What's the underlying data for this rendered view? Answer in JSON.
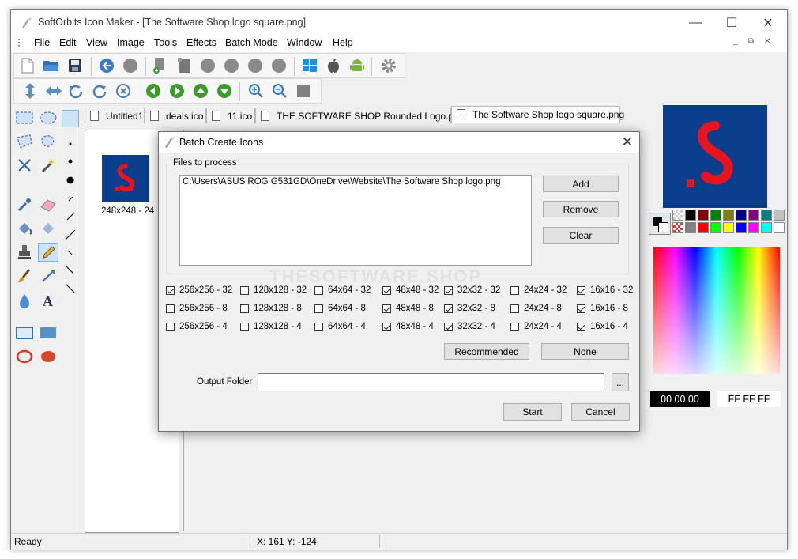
{
  "window": {
    "title": "SoftOrbits Icon Maker - [The Software Shop logo square.png]",
    "minimize": "—",
    "maximize": "☐",
    "close": "✕"
  },
  "menu": {
    "items": [
      "File",
      "Edit",
      "View",
      "Image",
      "Tools",
      "Effects",
      "Batch Mode",
      "Window",
      "Help"
    ],
    "mdi_buttons": [
      "_",
      "⧉",
      "✕"
    ]
  },
  "tabs": [
    {
      "label": "Untitled1",
      "active": false
    },
    {
      "label": "deals.ico",
      "active": false
    },
    {
      "label": "11.ico",
      "active": false
    },
    {
      "label": "THE SOFTWARE SHOP Rounded Logo.png",
      "active": false
    },
    {
      "label": "The Software Shop logo square.png",
      "active": true
    }
  ],
  "icon_list": {
    "item_label": "248x248 - 24"
  },
  "colors": {
    "hex_black": "00 00 00",
    "hex_white": "FF FF FF",
    "logo_bg": "#0a3d8c",
    "logo_fg": "#e6141e",
    "palette_row1": [
      "#000000",
      "#800000",
      "#008000",
      "#808000",
      "#000080",
      "#800080",
      "#008080",
      "#c0c0c0"
    ],
    "palette_row2": [
      "#808080",
      "#ff0000",
      "#00ff00",
      "#ffff00",
      "#0000ff",
      "#ff00ff",
      "#00ffff",
      "#ffffff"
    ]
  },
  "status": {
    "left": "Ready",
    "coords": "X: 161 Y: -124"
  },
  "dialog": {
    "title": "Batch Create Icons",
    "files_group_label": "Files to process",
    "files": [
      "C:\\Users\\ASUS ROG G531GD\\OneDrive\\Website\\The Software Shop logo.png"
    ],
    "add_label": "Add",
    "remove_label": "Remove",
    "clear_label": "Clear",
    "watermark": "THESOFTWARE.SHOP",
    "sizes": [
      [
        {
          "label": "256x256 - 32",
          "checked": true
        },
        {
          "label": "128x128 - 32",
          "checked": false
        },
        {
          "label": "64x64 - 32",
          "checked": false
        },
        {
          "label": "48x48 - 32",
          "checked": true
        },
        {
          "label": "32x32 - 32",
          "checked": true
        },
        {
          "label": "24x24 - 32",
          "checked": false
        },
        {
          "label": "16x16 - 32",
          "checked": true
        }
      ],
      [
        {
          "label": "256x256 - 8",
          "checked": false
        },
        {
          "label": "128x128 - 8",
          "checked": false
        },
        {
          "label": "64x64 - 8",
          "checked": false
        },
        {
          "label": "48x48 - 8",
          "checked": true
        },
        {
          "label": "32x32 - 8",
          "checked": true
        },
        {
          "label": "24x24 - 8",
          "checked": false
        },
        {
          "label": "16x16 - 8",
          "checked": true
        }
      ],
      [
        {
          "label": "256x256 - 4",
          "checked": false
        },
        {
          "label": "128x128 - 4",
          "checked": false
        },
        {
          "label": "64x64 - 4",
          "checked": false
        },
        {
          "label": "48x48 - 4",
          "checked": true
        },
        {
          "label": "32x32 - 4",
          "checked": true
        },
        {
          "label": "24x24 - 4",
          "checked": false
        },
        {
          "label": "16x16 - 4",
          "checked": true
        }
      ]
    ],
    "recommended_label": "Recommended",
    "none_label": "None",
    "output_folder_label": "Output Folder",
    "output_folder_value": "",
    "browse_label": "...",
    "start_label": "Start",
    "cancel_label": "Cancel"
  }
}
